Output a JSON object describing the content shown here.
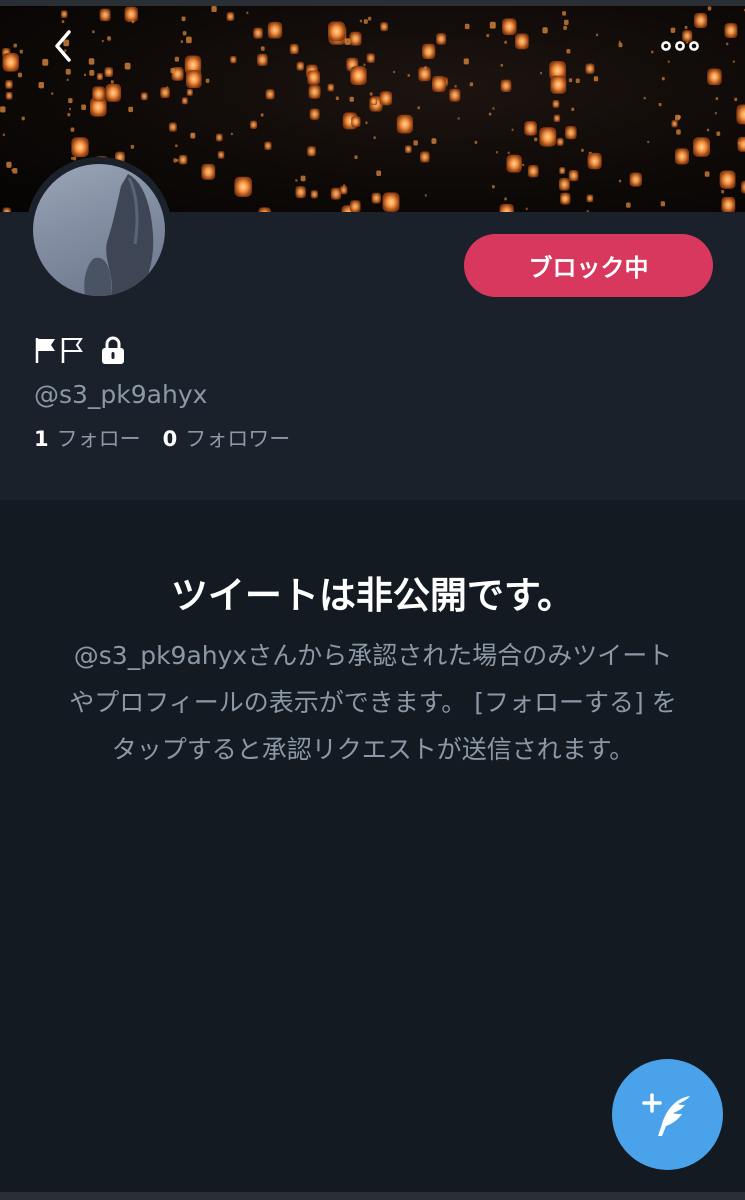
{
  "header": {
    "back_icon": "chevron-left-icon",
    "more_icon": "more-dots-icon",
    "banner_image": "sky-lanterns-banner"
  },
  "profile": {
    "avatar": "profile-avatar-photo",
    "flags_icon": "flag-icons",
    "lock_icon": "lock-icon",
    "handle": "@s3_pk9ahyx",
    "following_count": "1",
    "following_label": "フォロー",
    "followers_count": "0",
    "followers_label": "フォロワー",
    "block_button_label": "ブロック中"
  },
  "private_notice": {
    "title": "ツイートは非公開です。",
    "description": "@s3_pk9ahyxさんから承認された場合のみツイートやプロフィールの表示ができます。 [フォローする] をタップすると承認リクエストが送信されます。"
  },
  "fab": {
    "icon": "compose-tweet-icon"
  },
  "colors": {
    "background": "#141a22",
    "profile_bg": "#1a212b",
    "block_button": "#d8385e",
    "fab": "#4aa3ea",
    "secondary_text": "#8b98a5"
  }
}
